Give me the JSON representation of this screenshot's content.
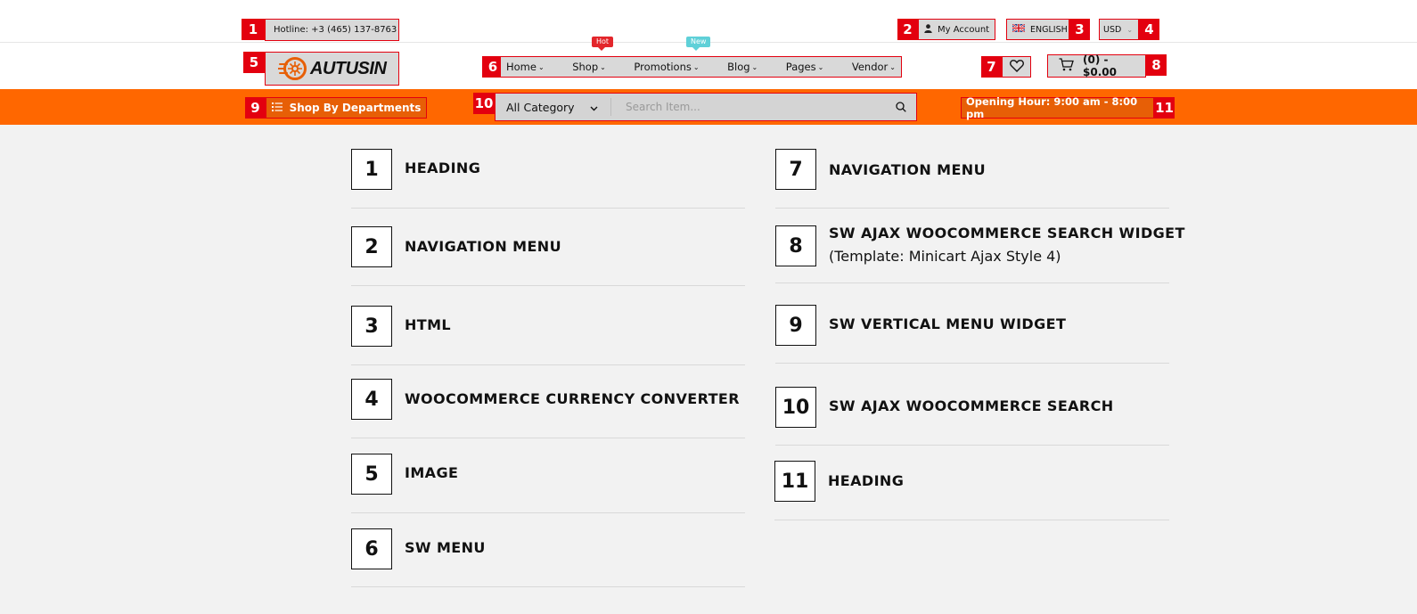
{
  "header": {
    "hotline": "Hotline: +3 (465) 137-8763",
    "account": "My Account",
    "language": "ENGLISH",
    "currency": "USD",
    "logo": "AUTUSIN",
    "nav": {
      "items": [
        "Home",
        "Shop",
        "Promotions",
        "Blog",
        "Pages",
        "Vendor"
      ],
      "badge_hot": "Hot",
      "badge_new": "New"
    },
    "cart": "(0) - $0.00",
    "departments": "Shop By Departments",
    "search": {
      "category": "All Category",
      "placeholder": "Search Item..."
    },
    "opening_hours": "Opening Hour: 9:00 am - 8:00 pm"
  },
  "markers": [
    "1",
    "2",
    "3",
    "4",
    "5",
    "6",
    "7",
    "8",
    "9",
    "10",
    "11"
  ],
  "widgets": {
    "left": [
      {
        "num": "1",
        "label": "HEADING"
      },
      {
        "num": "2",
        "label": "NAVIGATION MENU"
      },
      {
        "num": "3",
        "label": "HTML"
      },
      {
        "num": "4",
        "label": "WOOCOMMERCE CURRENCY CONVERTER"
      },
      {
        "num": "5",
        "label": "IMAGE"
      },
      {
        "num": "6",
        "label": "SW MENU"
      }
    ],
    "right": [
      {
        "num": "7",
        "label": "NAVIGATION MENU"
      },
      {
        "num": "8",
        "label": "SW AJAX WOOCOMMERCE SEARCH WIDGET",
        "sub": "(Template: Minicart Ajax Style 4)"
      },
      {
        "num": "9",
        "label": "SW VERTICAL MENU WIDGET"
      },
      {
        "num": "10",
        "label": "SW AJAX WOOCOMMERCE SEARCH"
      },
      {
        "num": "11",
        "label": "HEADING"
      }
    ]
  },
  "colors": {
    "accent": "#ff6700",
    "marker": "#e3000f",
    "hot": "#e3262b",
    "new": "#5fd0d8"
  }
}
